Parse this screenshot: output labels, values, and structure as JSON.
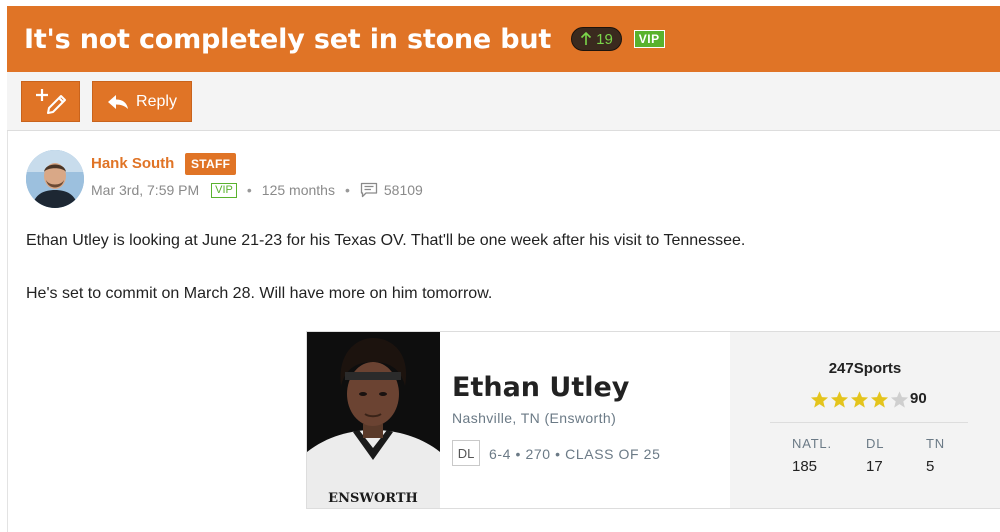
{
  "thread": {
    "title": "It's not completely set in stone but",
    "upvotes": "19",
    "vip_label": "VIP"
  },
  "toolbar": {
    "reply_label": "Reply"
  },
  "post": {
    "author": "Hank South",
    "role_badge": "STAFF",
    "date": "Mar 3rd, 7:59 PM",
    "vip_label": "VIP",
    "tenure": "125 months",
    "post_count": "58109",
    "paragraphs": [
      "Ethan Utley is looking at June 21-23 for his Texas OV. That'll be one week after his visit to Tennessee.",
      "He's set to commit on March 28. Will have more on him tomorrow."
    ]
  },
  "player_card": {
    "name": "Ethan Utley",
    "location": "Nashville, TN (Ensworth)",
    "position": "DL",
    "info": "6-4 • 270 • CLASS OF 25",
    "jersey_text": "ENSWORTH",
    "rating": {
      "source": "247Sports",
      "stars": 4,
      "max_stars": 5,
      "score": "90",
      "star_color": "#e4c41c"
    },
    "ranks": [
      {
        "label": "NATL.",
        "value": "185"
      },
      {
        "label": "DL",
        "value": "17"
      },
      {
        "label": "TN",
        "value": "5"
      }
    ]
  },
  "colors": {
    "brand_orange": "#e07426",
    "vip_green": "#59b22d",
    "vote_green": "#7bd64a"
  }
}
